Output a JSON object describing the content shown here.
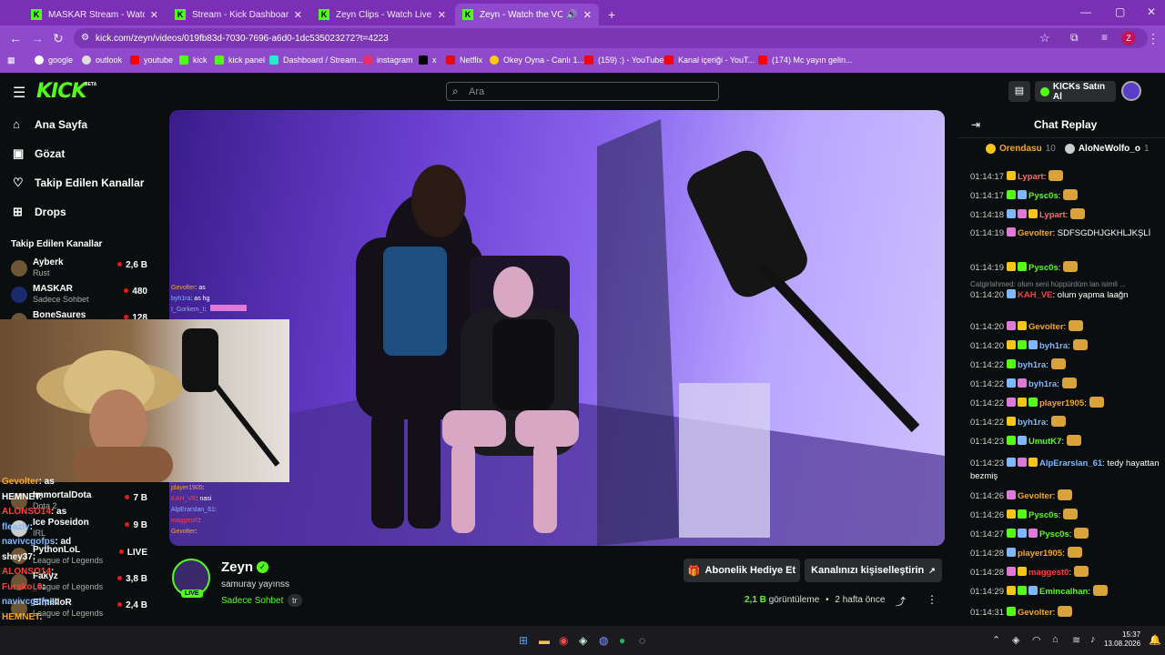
{
  "browser": {
    "tabs": [
      {
        "label": "MASKAR Stream - Watch Live o"
      },
      {
        "label": "Stream - Kick Dashboard"
      },
      {
        "label": "Zeyn Clips - Watch Live on Kick"
      },
      {
        "label": "Zeyn - Watch the VOD on K"
      }
    ],
    "url": "kick.com/zeyn/videos/019fb83d-7030-7696-a6d0-1dc535023272?t=4223",
    "profile_letter": "Z",
    "bookmarks": [
      "google",
      "outlook",
      "youtube",
      "kick",
      "kick panel",
      "Dashboard / Stream...",
      "instagram",
      "x",
      "Netflix",
      "Okey Oyna - Canlı 1...",
      "(159) :) - YouTube",
      "Kanal içeriği - YouT...",
      "(174) Mc yayın gelin..."
    ]
  },
  "header": {
    "logo": "KICK",
    "logo_badge": "BETA",
    "search_placeholder": "Ara",
    "buy_kicks": "KICKs Satın Al"
  },
  "sidebar": {
    "nav": [
      {
        "label": "Ana Sayfa",
        "icon": "home-icon"
      },
      {
        "label": "Gözat",
        "icon": "browse-icon"
      },
      {
        "label": "Takip Edilen Kanallar",
        "icon": "heart-icon"
      },
      {
        "label": "Drops",
        "icon": "drops-icon"
      }
    ],
    "followed_title": "Takip Edilen Kanallar",
    "channels": [
      {
        "name": "Ayberk",
        "category": "Rust",
        "viewers": "2,6 B"
      },
      {
        "name": "MASKAR",
        "category": "Sadece Sohbet",
        "viewers": "480"
      },
      {
        "name": "BoneSaures",
        "category": "",
        "viewers": "128"
      },
      {
        "name": "ImmortalDota",
        "category": "Dota 2",
        "viewers": "7 B"
      },
      {
        "name": "Ice Poseidon",
        "category": "IRL",
        "viewers": "9 B"
      },
      {
        "name": "PythonLoL",
        "category": "League of Legends",
        "viewers": "LIVE"
      },
      {
        "name": "Fakyz",
        "category": "League of Legends",
        "viewers": "3,8 B"
      },
      {
        "name": "ElmiilloR",
        "category": "League of Legends",
        "viewers": "2,4 B"
      }
    ]
  },
  "overlay": {
    "chat_top": [
      {
        "user": "Gevolter",
        "text": ": as"
      },
      {
        "user": "byh1ra",
        "text": ": as hg"
      },
      {
        "user": "I_Gorkem_I",
        "text": ":"
      }
    ],
    "chat_bottom": [
      {
        "user": "player1905",
        "text": ":"
      },
      {
        "user": "KAH_VE",
        "text": ": nasi"
      },
      {
        "user": "AlpErarslan_61",
        "text": ":"
      },
      {
        "user": "maggest0",
        "text": ":"
      },
      {
        "user": "Gevolter",
        "text": ":"
      }
    ],
    "cam_chat": [
      {
        "user": "Gevolter",
        "text": ": as"
      },
      {
        "user": "HEMNET",
        "text": ":"
      },
      {
        "user": "ALONSO14",
        "text": ": as"
      },
      {
        "user": "fleazly",
        "text": ":"
      },
      {
        "user": "navivcgofps",
        "text": ": ad"
      },
      {
        "user": "shey37",
        "text": ":"
      },
      {
        "user": "ALONSO14",
        "text": ":"
      },
      {
        "user": "Fursko_0",
        "text": ":"
      },
      {
        "user": "navivcgofps",
        "text": ":"
      },
      {
        "user": "HEMNET",
        "text": ":"
      }
    ]
  },
  "channel": {
    "name": "Zeyn",
    "title": "samuray yayınss",
    "category": "Sadece Sohbet",
    "tag": "tr",
    "live": "LIVE",
    "gift_button": "Abonelik Hediye Et",
    "customize_button": "Kanalınızı kişiselleştirin",
    "views": "2,1 B",
    "views_label": "görüntüleme",
    "age": "2 hafta önce"
  },
  "chat": {
    "title": "Chat Replay",
    "pinned": [
      {
        "user": "Orendasu",
        "count": "10"
      },
      {
        "user": "AloNeWolfo_o",
        "count": "1"
      }
    ],
    "messages": [
      {
        "time": "01:14:17",
        "user": "Lypart",
        "color": "#ff6b6b",
        "text": ":"
      },
      {
        "time": "01:14:17",
        "user": "Pysc0s",
        "color": "#53fc18",
        "text": ":"
      },
      {
        "time": "01:14:18",
        "user": "Lypart",
        "color": "#ff6b6b",
        "text": ":"
      },
      {
        "time": "01:14:19",
        "user": "Gevolter",
        "color": "#f5a623",
        "text": ": SDFSGDHJGKHLJKŞLİ"
      },
      {
        "time": "01:14:19",
        "user": "Pysc0s",
        "color": "#53fc18",
        "text": ":"
      },
      {
        "system": "Catgirlahmed: olum seni hüppürdüm lan isimli ..."
      },
      {
        "time": "01:14:20",
        "user": "KAH_VE",
        "color": "#ff3d3d",
        "text": ": olum yapma laağn"
      },
      {
        "time": "01:14:20",
        "user": "Gevolter",
        "color": "#f5a623",
        "text": ":"
      },
      {
        "time": "01:14:20",
        "user": "byh1ra",
        "color": "#7eb8ff",
        "text": ":"
      },
      {
        "time": "01:14:22",
        "user": "byh1ra",
        "color": "#7eb8ff",
        "text": ":"
      },
      {
        "time": "01:14:22",
        "user": "byh1ra",
        "color": "#7eb8ff",
        "text": ":"
      },
      {
        "time": "01:14:22",
        "user": "player1905",
        "color": "#f5a623",
        "text": ":"
      },
      {
        "time": "01:14:22",
        "user": "byh1ra",
        "color": "#7eb8ff",
        "text": ":"
      },
      {
        "time": "01:14:23",
        "user": "UmutK7",
        "color": "#53fc18",
        "text": ":"
      },
      {
        "time": "01:14:23",
        "user": "AlpErarslan_61",
        "color": "#7eb8ff",
        "text": ": tedy hayattan bezmiş"
      },
      {
        "time": "01:14:26",
        "user": "Gevolter",
        "color": "#f5a623",
        "text": ":"
      },
      {
        "time": "01:14:26",
        "user": "Pysc0s",
        "color": "#53fc18",
        "text": ":"
      },
      {
        "time": "01:14:27",
        "user": "Pysc0s",
        "color": "#53fc18",
        "text": ":"
      },
      {
        "time": "01:14:28",
        "user": "player1905",
        "color": "#f5a623",
        "text": ":"
      },
      {
        "time": "01:14:28",
        "user": "maggest0",
        "color": "#ff3d3d",
        "text": ":"
      },
      {
        "time": "01:14:29",
        "user": "Emincalhan",
        "color": "#53fc18",
        "text": ":"
      },
      {
        "time": "01:14:31",
        "user": "Gevolter",
        "color": "#f5a623",
        "text": ":"
      }
    ]
  },
  "taskbar": {
    "time": "15:37",
    "date": "13.08.2026"
  },
  "colors": {
    "kick_green": "#53fc18",
    "chrome_purple": "#8e4acb",
    "bg": "#0b0e0f"
  }
}
